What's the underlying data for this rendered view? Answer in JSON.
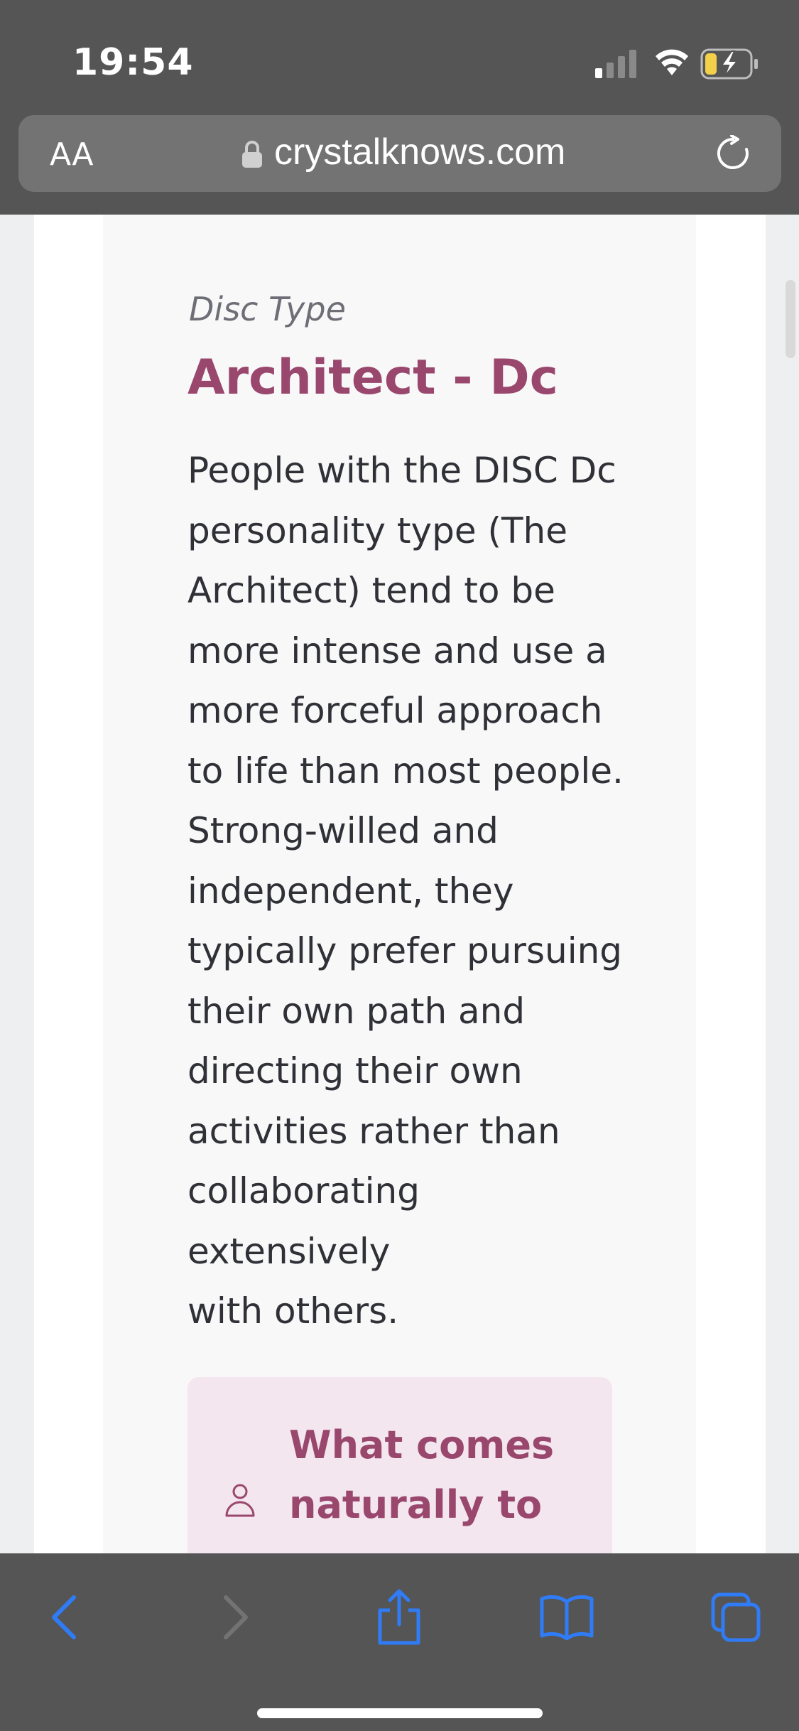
{
  "status_bar": {
    "time": "19:54"
  },
  "address_bar": {
    "text_size_label": "AA",
    "url": "crystalknows.com"
  },
  "content": {
    "eyebrow": "Disc Type",
    "title": "Architect - Dc",
    "description_lines": [
      "People with the DISC Dc",
      "personality type (The",
      "Architect) tend to be",
      "more intense and use a",
      "more forceful approach",
      "to life than most people.",
      "Strong-willed and",
      "independent, they",
      "typically prefer pursuing",
      "their own path and",
      "directing their own",
      "activities rather than",
      "collaborating extensively",
      "with others."
    ],
    "callout_title_lines": [
      "What comes",
      "naturally to"
    ]
  },
  "toolbar": {
    "icons": [
      "back-icon",
      "forward-icon",
      "share-icon",
      "bookmarks-icon",
      "tabs-icon"
    ]
  },
  "colors": {
    "accent": "#9a476e",
    "callout_bg": "#f3e6ef",
    "chrome": "#555556",
    "toolbar_icon": "#2f7cf6"
  }
}
